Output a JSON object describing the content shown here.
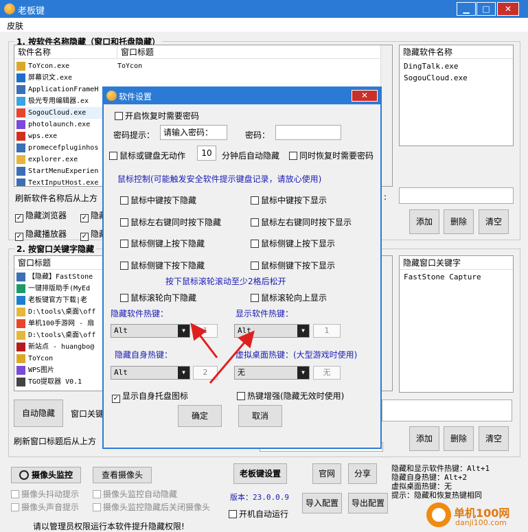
{
  "window": {
    "title": "老板键",
    "minimize": "▁",
    "maximize": "□",
    "close": "✕"
  },
  "menu": {
    "skin": "皮肤"
  },
  "section1": {
    "legend": "1. 按软件名称隐藏（窗口和托盘隐藏）",
    "col_name": "软件名称",
    "col_title": "窗口标题",
    "rows": [
      {
        "name": "ToYcon.exe",
        "title": "ToYcon",
        "icon": "ToYcon-icon",
        "color": "#d9a82a"
      },
      {
        "name": "屏幕识文.exe",
        "title": "",
        "icon": "text-recognition-icon",
        "color": "#1e6fd0"
      },
      {
        "name": "ApplicationFrameH",
        "title": "",
        "icon": "window-frame-icon",
        "color": "#3b6fb6"
      },
      {
        "name": "极光专用编辑器.ex",
        "title": "",
        "icon": "editor-icon",
        "color": "#3aa5e0"
      },
      {
        "name": "SogouCloud.exe",
        "title": "",
        "icon": "sogou-icon",
        "color": "#e8452c"
      },
      {
        "name": "photolaunch.exe",
        "title": "",
        "icon": "photo-icon",
        "color": "#7a4bd6"
      },
      {
        "name": "wps.exe",
        "title": "",
        "icon": "wps-icon",
        "color": "#d2301e"
      },
      {
        "name": "promecefpluginhos",
        "title": "",
        "icon": "plugin-icon",
        "color": "#3b6fb6"
      },
      {
        "name": "explorer.exe",
        "title": "",
        "icon": "folder-icon",
        "color": "#e5b73b"
      },
      {
        "name": "StartMenuExperien",
        "title": "",
        "icon": "start-menu-icon",
        "color": "#3b6fb6"
      },
      {
        "name": "TextInputHost.exe",
        "title": "",
        "icon": "input-icon",
        "color": "#3b6fb6"
      }
    ],
    "hidden_header": "隐藏软件名称",
    "hidden_items": [
      "DingTalk.exe",
      "SogouCloud.exe"
    ],
    "refresh_label": "刷新软件名称后从上方",
    "colon": ":",
    "checks": [
      {
        "label": "隐藏浏览器",
        "checked": true
      },
      {
        "label": "隐藏",
        "checked": true
      },
      {
        "label": "隐藏播放器",
        "checked": true
      },
      {
        "label": "隐藏",
        "checked": true
      }
    ],
    "add": "添加",
    "delete": "删除",
    "clear": "清空"
  },
  "section2": {
    "legend": "2. 按窗口关键字隐藏",
    "col_title": "窗口标题",
    "rows": [
      {
        "text": "【隐藏】FastStone",
        "icon": "faststone-icon",
        "color": "#3b6fb6"
      },
      {
        "text": "一键排版助手(MyEd",
        "icon": "typeset-icon",
        "color": "#1e9a6a"
      },
      {
        "text": "老板键官方下载|老",
        "icon": "edge-icon",
        "color": "#1d7fd1"
      },
      {
        "text": "D:\\tools\\桌面\\off",
        "icon": "folder-icon",
        "color": "#e5b73b"
      },
      {
        "text": "单机100手游网 - 扇",
        "icon": "browser-icon",
        "color": "#e8452c"
      },
      {
        "text": "D:\\tools\\桌面\\off",
        "icon": "folder-icon",
        "color": "#e5b73b"
      },
      {
        "text": "新站点 - huangbo@",
        "icon": "filezilla-icon",
        "color": "#b71c1c"
      },
      {
        "text": "ToYcon",
        "icon": "ToYcon-icon",
        "color": "#d9a82a"
      },
      {
        "text": "WPS图片",
        "icon": "wps-icon",
        "color": "#7a4bd6"
      },
      {
        "text": "TGO提取器 V0.1",
        "icon": "tool-icon",
        "color": "#444"
      }
    ],
    "keyword_header": "隐藏窗口关键字",
    "keyword_items": [
      "FastStone Capture"
    ],
    "auto_hide": "自动隐藏",
    "window_key_label": "窗口关键",
    "refresh_label": "刷新窗口标题后从上方",
    "add": "添加",
    "delete": "删除",
    "clear": "清空"
  },
  "bottom": {
    "camera_monitor": "摄像头监控",
    "view_camera": "查看摄像头",
    "camera_opts": [
      "摄像头抖动提示",
      "摄像头监控自动隐藏",
      "摄像头声音提示",
      "摄像头监控隐藏后关闭摄像头"
    ],
    "admin_note": "请以管理员权限运行本软件提升隐藏权限!",
    "settings": "老板键设置",
    "official": "官网",
    "share": "分享",
    "version": "版本：23.0.0.9",
    "import": "导入配置",
    "export": "导出配置",
    "autostart": "开机自动运行",
    "hotkey_info": [
      "隐藏和显示软件热键：Alt+1",
      "隐藏自身热键：Alt+2",
      "虚拟桌面热键：无",
      "提示：隐藏和恢复热键相同"
    ]
  },
  "dialog": {
    "title": "软件设置",
    "close": "✕",
    "pwd_on_restore": "开启恢复时需要密码",
    "pwd_hint_label": "密码提示：",
    "pwd_hint_placeholder": "请输入密码：",
    "pwd_label": "密码：",
    "idle_label": "鼠标或键盘无动作",
    "idle_minutes": "10",
    "idle_suffix": "分钟后自动隐藏",
    "restore_pwd": "同时恢复时需要密码",
    "mouse_note": "鼠标控制(可能触发安全软件提示键盘记录，请放心使用)",
    "mouse_opts": [
      "鼠标中键按下隐藏",
      "鼠标中键按下显示",
      "鼠标左右键同时按下隐藏",
      "鼠标左右键同时按下显示",
      "鼠标侧键上按下隐藏",
      "鼠标侧键上按下显示",
      "鼠标侧键下按下隐藏",
      "鼠标侧键下按下显示"
    ],
    "wheel_note": "按下鼠标滚轮滚动至少2格后松开",
    "wheel_down": "鼠标滚轮向下隐藏",
    "wheel_up": "鼠标滚轮向上显示",
    "hide_hotkey_label": "隐藏软件热键：",
    "hide_hotkey_mod": "Alt",
    "hide_hotkey_key": "1",
    "show_hotkey_label": "显示软件热键：",
    "show_hotkey_mod": "Alt",
    "show_hotkey_key": "1",
    "self_hotkey_label": "隐藏自身热键：",
    "self_hotkey_mod": "Alt",
    "self_hotkey_key": "2",
    "vdesk_hotkey_label": "虚拟桌面热键：(大型游戏时使用)",
    "vdesk_hotkey_mod": "无",
    "vdesk_hotkey_key": "无",
    "tray_icon": "显示自身托盘图标",
    "hotkey_boost": "热键增强(隐藏无效时使用)",
    "ok": "确定",
    "cancel": "取消",
    "arrow_color": "#e02020"
  },
  "watermark": {
    "text": "单机100网",
    "sub": "danji100.com"
  }
}
